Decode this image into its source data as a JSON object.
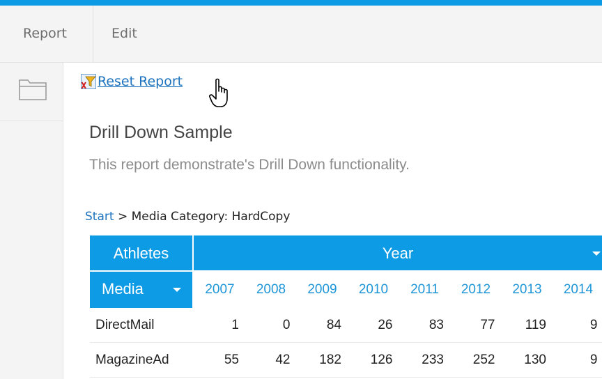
{
  "menu": {
    "report_label": "Report",
    "edit_label": "Edit"
  },
  "toolbar": {
    "reset_label": "Reset Report"
  },
  "report": {
    "title": "Drill Down Sample",
    "description": "This report demonstrate's Drill Down functionality."
  },
  "breadcrumb": {
    "start": "Start",
    "separator": ">",
    "current": "Media Category: HardCopy"
  },
  "table": {
    "row_header": "Athletes",
    "column_group": "Year",
    "dimension": "Media",
    "years": [
      "2007",
      "2008",
      "2009",
      "2010",
      "2011",
      "2012",
      "2013",
      "2014"
    ],
    "rows": [
      {
        "label": "DirectMail",
        "values": [
          "1",
          "0",
          "84",
          "26",
          "83",
          "77",
          "119",
          "9"
        ]
      },
      {
        "label": "MagazineAd",
        "values": [
          "55",
          "42",
          "182",
          "126",
          "233",
          "252",
          "130",
          "9"
        ]
      }
    ]
  },
  "colors": {
    "accent": "#0e9be6",
    "link": "#1e73be"
  },
  "icons": {
    "folder": "folder-icon",
    "reset": "reset-filter-icon",
    "cursor": "hand-pointer-icon"
  }
}
